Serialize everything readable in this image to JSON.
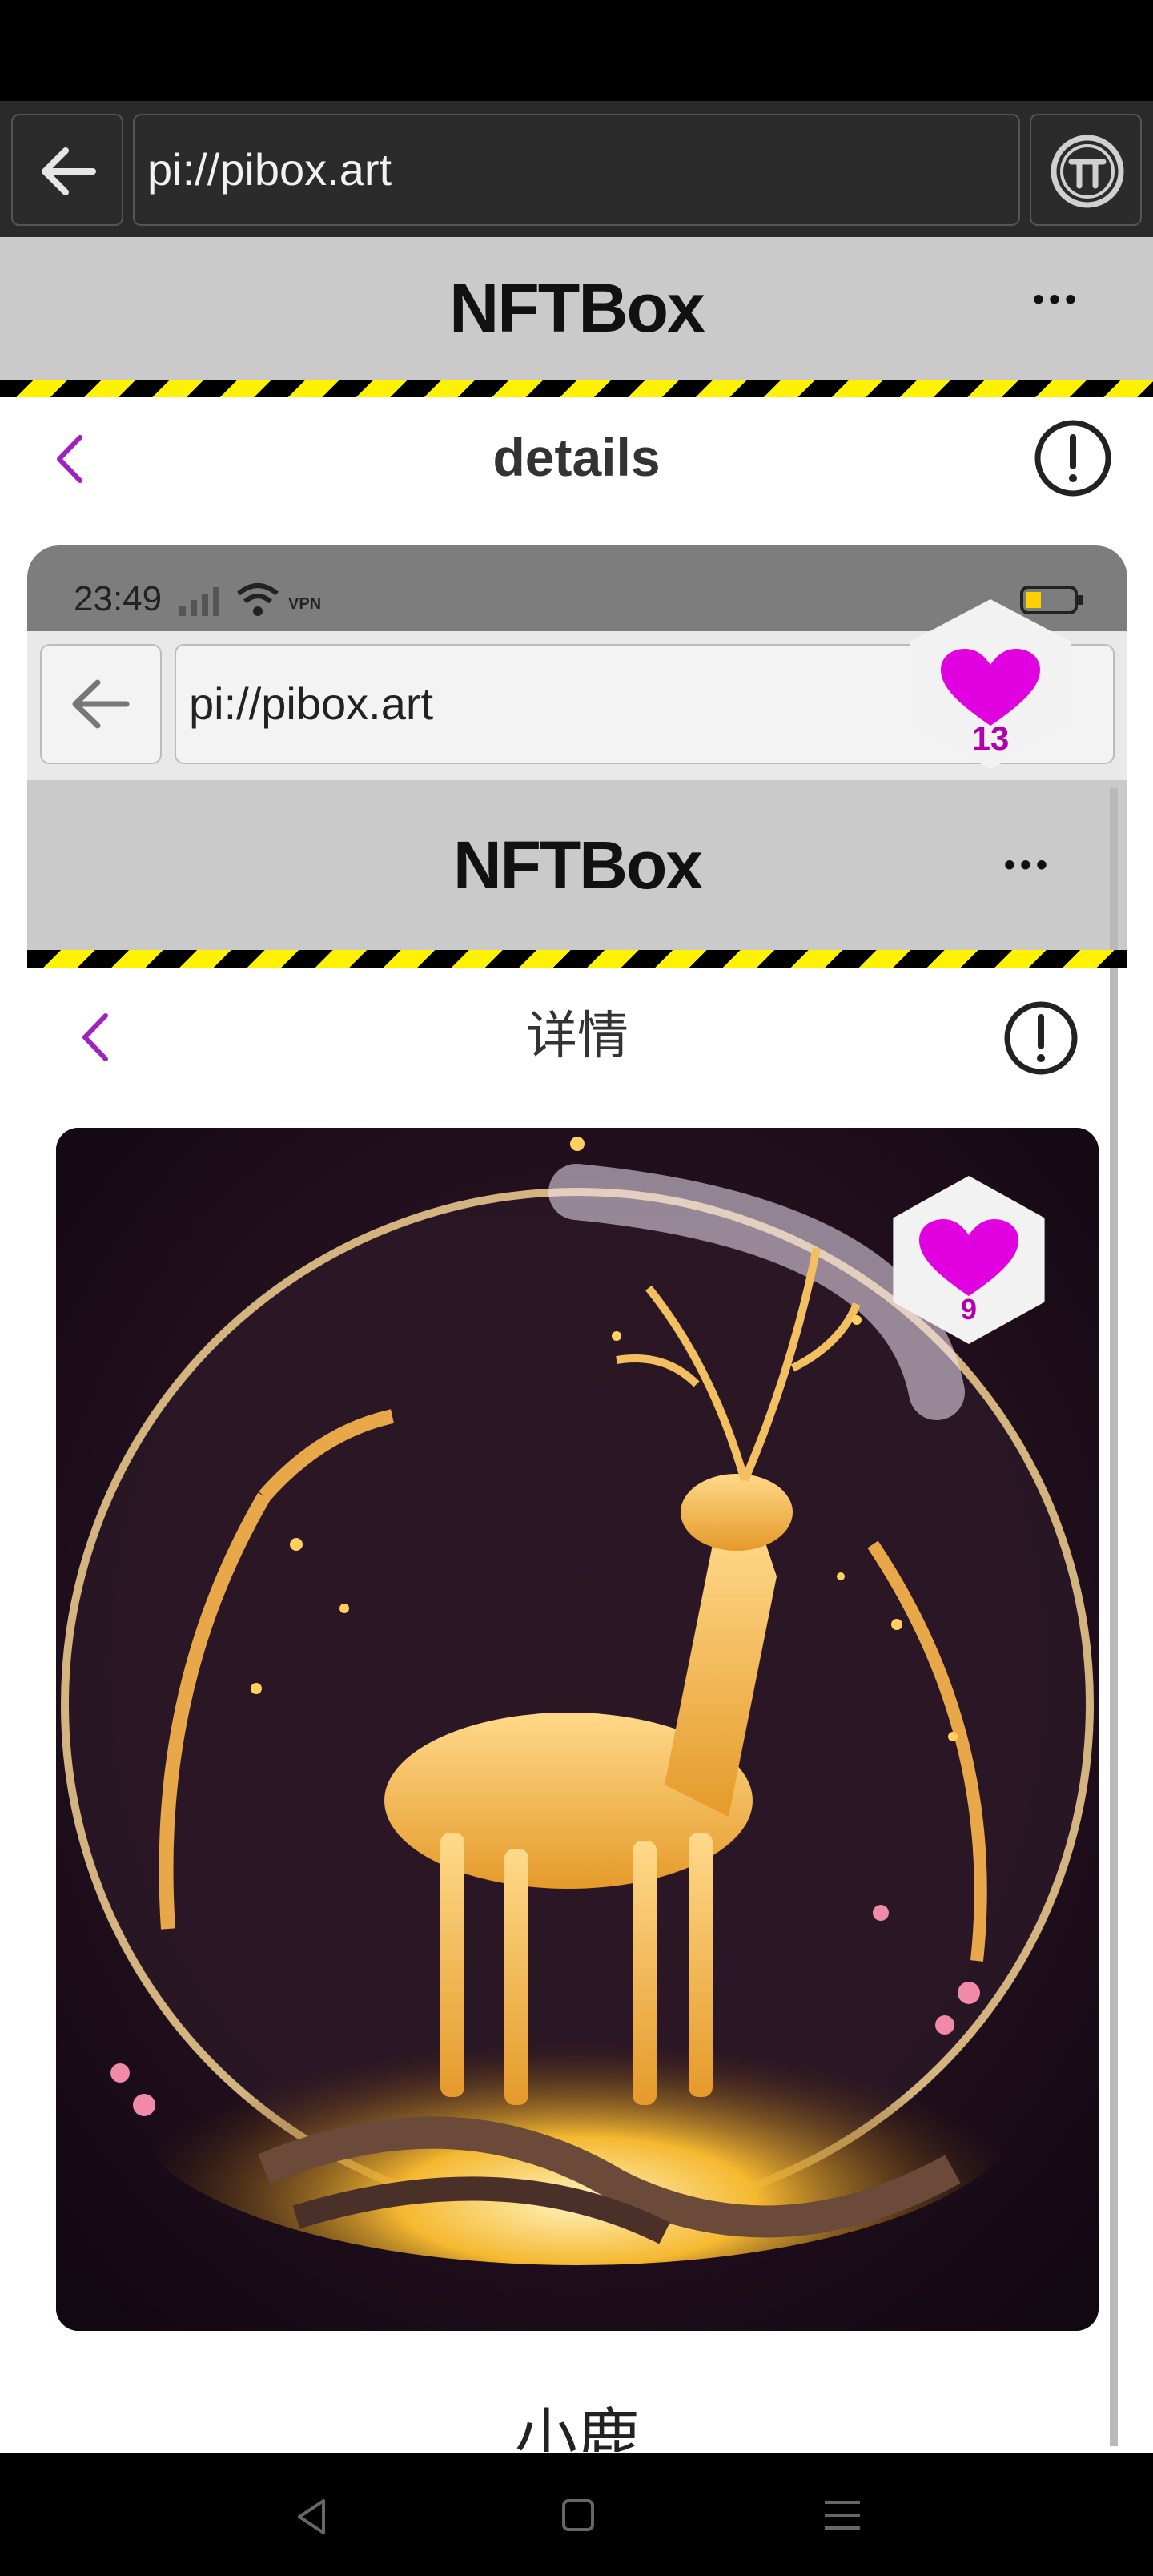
{
  "browser": {
    "url": "pi://pibox.art",
    "back_icon": "arrow-left-icon",
    "pi_icon": "pi-logo-icon"
  },
  "app": {
    "title": "NFTBox",
    "more_label": "•••"
  },
  "page": {
    "title": "details",
    "back_icon": "chevron-left-icon",
    "info_icon": "info-circle-icon"
  },
  "screenshot": {
    "status_time": "23:49",
    "vpn_label": "VPN",
    "url": "pi://pibox.art",
    "like_count": "13",
    "app_title": "NFTBox",
    "more_label": "•••",
    "page_title": "详情",
    "image_like_count": "9",
    "nft_name": "小鹿"
  },
  "colors": {
    "accent_purple": "#a020c0",
    "heart_magenta": "#e000e0",
    "stripe_yellow": "#fff200"
  }
}
